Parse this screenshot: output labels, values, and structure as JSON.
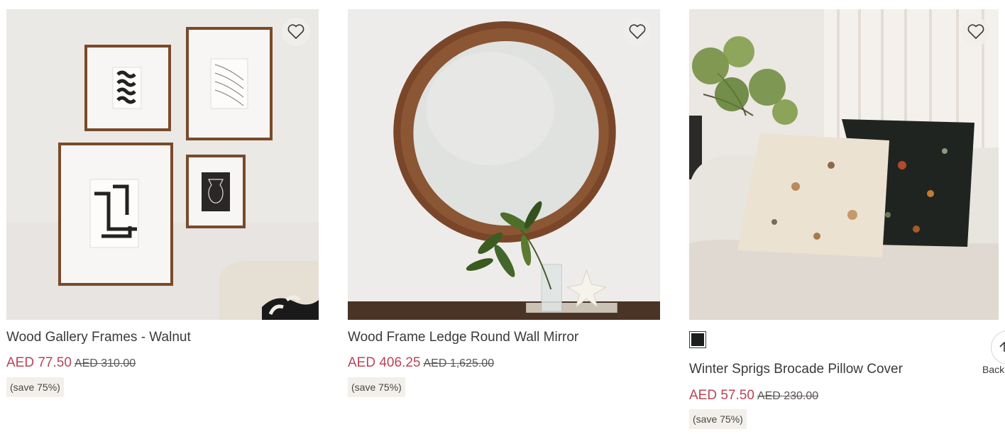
{
  "products": [
    {
      "title": "Wood Gallery Frames - Walnut",
      "sale_price": "AED 77.50",
      "original_price": "AED 310.00",
      "save_badge": "(save 75%)"
    },
    {
      "title": "Wood Frame Ledge Round Wall Mirror",
      "sale_price": "AED 406.25",
      "original_price": "AED 1,625.00",
      "save_badge": "(save 75%)"
    },
    {
      "title": "Winter Sprigs Brocade Pillow Cover",
      "sale_price": "AED 57.50",
      "original_price": "AED 230.00",
      "save_badge": "(save 75%)",
      "swatch_color": "#1c1f1d"
    }
  ],
  "wishlist_icon": "heart-icon",
  "back_to_top": {
    "label": "Back",
    "icon": "arrow-up-icon"
  },
  "colors": {
    "sale": "#b84456",
    "text": "#3d3a38",
    "badge_bg": "#f3efea"
  }
}
